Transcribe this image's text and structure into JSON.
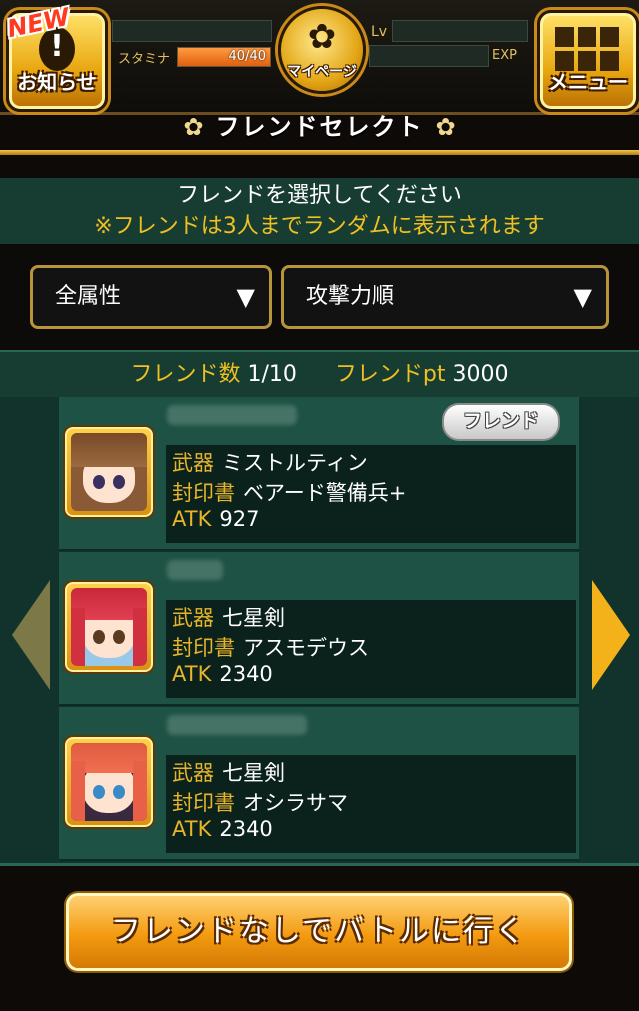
{
  "header": {
    "news_badge": "NEW",
    "news_label": "お知らせ",
    "stamina_label": "スタミナ",
    "stamina_value": "40/40",
    "stamina_fraction": 1.0,
    "mypage_label": "マイページ",
    "lv_label": "Lv",
    "exp_label": "EXP",
    "menu_label": "メニュー"
  },
  "title": "フレンドセレクト",
  "instructions": {
    "line1": "フレンドを選択してください",
    "line2": "※フレンドは3人までランダムに表示されます"
  },
  "filters": {
    "attribute": "全属性",
    "sort": "攻撃力順"
  },
  "counts": {
    "friend_count_label": "フレンド数",
    "friend_count_value": "1/10",
    "friend_pt_label": "フレンドpt",
    "friend_pt_value": "3000"
  },
  "labels": {
    "weapon": "武器",
    "seal": "封印書",
    "atk": "ATK"
  },
  "friends": [
    {
      "badge": "フレンド",
      "weapon": "ミストルティン",
      "seal": "ベアード警備兵+",
      "atk": "927"
    },
    {
      "badge": "",
      "weapon": "七星剣",
      "seal": "アスモデウス",
      "atk": "2340"
    },
    {
      "badge": "",
      "weapon": "七星剣",
      "seal": "オシラサマ",
      "atk": "2340"
    }
  ],
  "battle_button": "フレンドなしでバトルに行く",
  "colors": {
    "accent_gold": "#f0c020",
    "panel_green": "#173d33",
    "button_orange": "#f39a10"
  }
}
